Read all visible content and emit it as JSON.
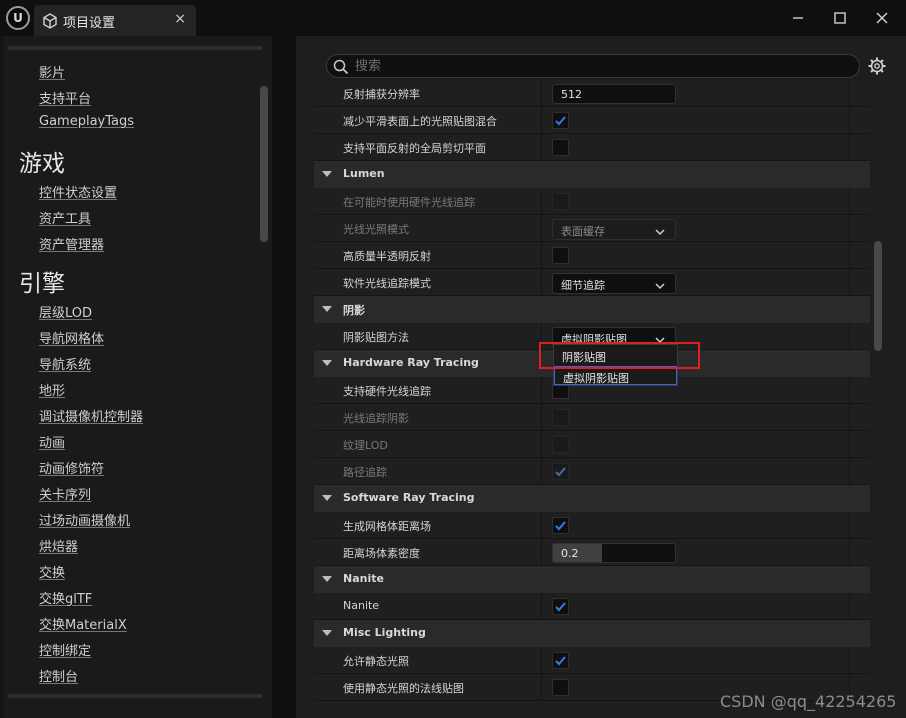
{
  "window": {
    "logo_text": "U",
    "tab_title": "项目设置",
    "tab_close": "×"
  },
  "left_panel": {
    "items": [
      {
        "label": "影片",
        "kind": "item"
      },
      {
        "label": "支持平台",
        "kind": "item"
      },
      {
        "label": "GameplayTags",
        "kind": "item"
      },
      {
        "label": "游戏",
        "kind": "heading"
      },
      {
        "label": "控件状态设置",
        "kind": "item"
      },
      {
        "label": "资产工具",
        "kind": "item"
      },
      {
        "label": "资产管理器",
        "kind": "item"
      },
      {
        "label": "引擎",
        "kind": "heading"
      },
      {
        "label": "层级LOD",
        "kind": "item"
      },
      {
        "label": "导航网格体",
        "kind": "item"
      },
      {
        "label": "导航系统",
        "kind": "item"
      },
      {
        "label": "地形",
        "kind": "item"
      },
      {
        "label": "调试摄像机控制器",
        "kind": "item"
      },
      {
        "label": "动画",
        "kind": "item"
      },
      {
        "label": "动画修饰符",
        "kind": "item"
      },
      {
        "label": "关卡序列",
        "kind": "item"
      },
      {
        "label": "过场动画摄像机",
        "kind": "item"
      },
      {
        "label": "烘焙器",
        "kind": "item"
      },
      {
        "label": "交换",
        "kind": "item"
      },
      {
        "label": "交换glTF",
        "kind": "item"
      },
      {
        "label": "交换MaterialX",
        "kind": "item"
      },
      {
        "label": "控制绑定",
        "kind": "item"
      },
      {
        "label": "控制台",
        "kind": "item"
      }
    ]
  },
  "search": {
    "placeholder": "搜索"
  },
  "settings": {
    "rows": [
      {
        "type": "prop",
        "label": "反射捕获分辨率",
        "control": "text",
        "value": "512"
      },
      {
        "type": "prop",
        "label": "减少平滑表面上的光照贴图混合",
        "control": "check",
        "checked": true
      },
      {
        "type": "prop",
        "label": "支持平面反射的全局剪切平面",
        "control": "check",
        "checked": false
      },
      {
        "type": "section",
        "label": "Lumen"
      },
      {
        "type": "prop",
        "label": "在可能时使用硬件光线追踪",
        "control": "check",
        "checked": false,
        "disabled": true
      },
      {
        "type": "prop",
        "label": "光线光照模式",
        "control": "combo",
        "value": "表面缓存",
        "disabled": true
      },
      {
        "type": "prop",
        "label": "高质量半透明反射",
        "control": "check",
        "checked": false
      },
      {
        "type": "prop",
        "label": "软件光线追踪模式",
        "control": "combo",
        "value": "细节追踪"
      },
      {
        "type": "section",
        "label": "阴影"
      },
      {
        "type": "prop",
        "label": "阴影贴图方法",
        "control": "combo",
        "value": "虚拟阴影贴图"
      },
      {
        "type": "section",
        "label": "Hardware Ray Tracing"
      },
      {
        "type": "prop",
        "label": "支持硬件光线追踪",
        "control": "check",
        "checked": false
      },
      {
        "type": "prop",
        "label": "光线追踪阴影",
        "control": "check",
        "checked": false,
        "disabled": true
      },
      {
        "type": "prop",
        "label": "纹理LOD",
        "control": "check",
        "checked": false,
        "disabled": true
      },
      {
        "type": "prop",
        "label": "路径追踪",
        "control": "check",
        "checked": true,
        "disabled": true
      },
      {
        "type": "section",
        "label": "Software Ray Tracing"
      },
      {
        "type": "prop",
        "label": "生成网格体距离场",
        "control": "check",
        "checked": true
      },
      {
        "type": "prop",
        "label": "距离场体素密度",
        "control": "slider",
        "value": "0.2",
        "fraction": 0.4
      },
      {
        "type": "section",
        "label": "Nanite"
      },
      {
        "type": "prop",
        "label": "Nanite",
        "control": "check",
        "checked": true
      },
      {
        "type": "section",
        "label": "Misc Lighting"
      },
      {
        "type": "prop",
        "label": "允许静态光照",
        "control": "check",
        "checked": true
      },
      {
        "type": "prop",
        "label": "使用静态光照的法线贴图",
        "control": "check",
        "checked": false
      }
    ]
  },
  "dropdown": {
    "options": [
      "阴影贴图",
      "虚拟阴影贴图"
    ]
  },
  "watermark": "CSDN @qq_42254265",
  "colors": {
    "check_mark": "#2f7fe8",
    "highlight": "#e02020",
    "selection": "#2f6bd0"
  }
}
